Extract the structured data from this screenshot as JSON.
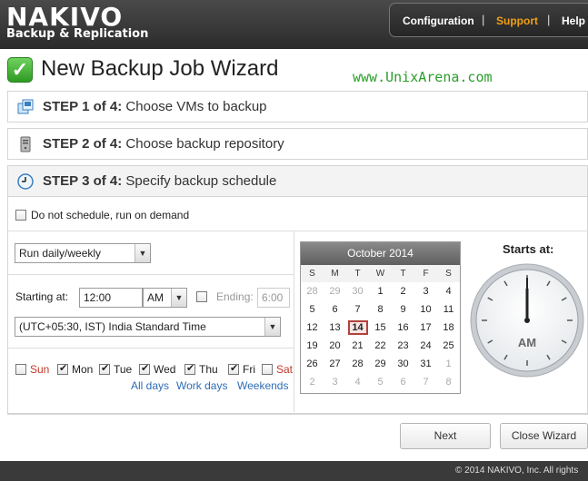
{
  "brand": {
    "name": "NAKIVO",
    "tagline": "Backup & Replication"
  },
  "nav": {
    "configuration": "Configuration",
    "support": "Support",
    "help": "Help",
    "separator": "|"
  },
  "wizard": {
    "title": "New Backup Job Wizard",
    "watermark": "www.UnixArena.com",
    "steps": [
      {
        "label": "STEP 1 of 4:",
        "text": "Choose VMs to backup",
        "icon": "vm-icon"
      },
      {
        "label": "STEP 2 of 4:",
        "text": "Choose backup repository",
        "icon": "repository-icon"
      },
      {
        "label": "STEP 3 of 4:",
        "text": "Specify backup schedule",
        "icon": "clock-icon"
      }
    ]
  },
  "schedule": {
    "no_schedule_label": "Do not schedule, run on demand",
    "frequency": "Run daily/weekly",
    "starting_at_label": "Starting at:",
    "start_time": "12:00",
    "start_ampm": "AM",
    "ending_label": "Ending:",
    "end_time": "6:00",
    "timezone": "(UTC+05:30, IST) India Standard Time",
    "days": [
      {
        "name": "Sun",
        "checked": false,
        "weekend": true
      },
      {
        "name": "Mon",
        "checked": true,
        "weekend": false
      },
      {
        "name": "Tue",
        "checked": true,
        "weekend": false
      },
      {
        "name": "Wed",
        "checked": true,
        "weekend": false
      },
      {
        "name": "Thu",
        "checked": true,
        "weekend": false
      },
      {
        "name": "Fri",
        "checked": true,
        "weekend": false
      },
      {
        "name": "Sat",
        "checked": false,
        "weekend": true
      }
    ],
    "links": {
      "all_days": "All days",
      "work_days": "Work days",
      "weekends": "Weekends"
    }
  },
  "calendar": {
    "month": "October 2014",
    "dow": [
      "S",
      "M",
      "T",
      "W",
      "T",
      "F",
      "S"
    ],
    "weeks": [
      [
        {
          "d": "28",
          "o": true
        },
        {
          "d": "29",
          "o": true
        },
        {
          "d": "30",
          "o": true
        },
        {
          "d": "1"
        },
        {
          "d": "2"
        },
        {
          "d": "3"
        },
        {
          "d": "4"
        }
      ],
      [
        {
          "d": "5"
        },
        {
          "d": "6"
        },
        {
          "d": "7"
        },
        {
          "d": "8"
        },
        {
          "d": "9"
        },
        {
          "d": "10"
        },
        {
          "d": "11"
        }
      ],
      [
        {
          "d": "12"
        },
        {
          "d": "13"
        },
        {
          "d": "14",
          "today": true
        },
        {
          "d": "15"
        },
        {
          "d": "16"
        },
        {
          "d": "17"
        },
        {
          "d": "18"
        }
      ],
      [
        {
          "d": "19"
        },
        {
          "d": "20"
        },
        {
          "d": "21"
        },
        {
          "d": "22"
        },
        {
          "d": "23"
        },
        {
          "d": "24"
        },
        {
          "d": "25"
        }
      ],
      [
        {
          "d": "26"
        },
        {
          "d": "27"
        },
        {
          "d": "28"
        },
        {
          "d": "29"
        },
        {
          "d": "30"
        },
        {
          "d": "31"
        },
        {
          "d": "1",
          "o": true
        }
      ],
      [
        {
          "d": "2",
          "o": true
        },
        {
          "d": "3",
          "o": true
        },
        {
          "d": "4",
          "o": true
        },
        {
          "d": "5",
          "o": true
        },
        {
          "d": "6",
          "o": true
        },
        {
          "d": "7",
          "o": true
        },
        {
          "d": "8",
          "o": true
        }
      ]
    ]
  },
  "clock": {
    "label": "Starts at:",
    "ampm": "AM",
    "time": "12:00"
  },
  "buttons": {
    "next": "Next",
    "close": "Close Wizard"
  },
  "footer": {
    "copyright": "© 2014 NAKIVO, Inc. All rights"
  },
  "colors": {
    "accent": "#f0a013",
    "watermark": "#2a9d2a",
    "weekend": "#c0392b",
    "link": "#2e6db4",
    "today_border": "#b3413b"
  }
}
